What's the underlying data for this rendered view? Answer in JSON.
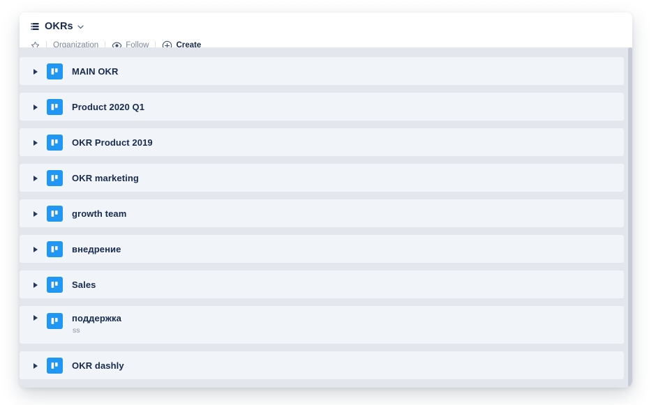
{
  "window": {
    "header": {
      "title": "OKRs",
      "title_icon": "board-list-icon",
      "chevron_icon": "chevron-down-icon",
      "meta": {
        "star_icon": "star-icon",
        "organization_label": "Organization",
        "eye_icon": "eye-icon",
        "follow_label": "Follow",
        "plus_icon": "plus-circle-icon",
        "create_label": "Create"
      }
    },
    "list": {
      "board_icon": "trello-board-icon",
      "expander_icon": "triangle-right-icon",
      "rows": [
        {
          "title": "MAIN OKR",
          "subtitle": ""
        },
        {
          "title": "Product 2020 Q1",
          "subtitle": ""
        },
        {
          "title": "OKR Product 2019",
          "subtitle": ""
        },
        {
          "title": "OKR marketing",
          "subtitle": ""
        },
        {
          "title": "growth team",
          "subtitle": ""
        },
        {
          "title": "внедрение",
          "subtitle": ""
        },
        {
          "title": "Sales",
          "subtitle": ""
        },
        {
          "title": "поддержка",
          "subtitle": "ss"
        },
        {
          "title": "OKR dashly",
          "subtitle": ""
        }
      ],
      "scrollbar": "vertical-scrollbar"
    }
  },
  "colors": {
    "accent_blue": "#2196f3",
    "row_background": "#f1f4f9",
    "list_background": "#e3e6ed",
    "text_primary": "#172b4d",
    "text_muted": "#7a869a"
  }
}
